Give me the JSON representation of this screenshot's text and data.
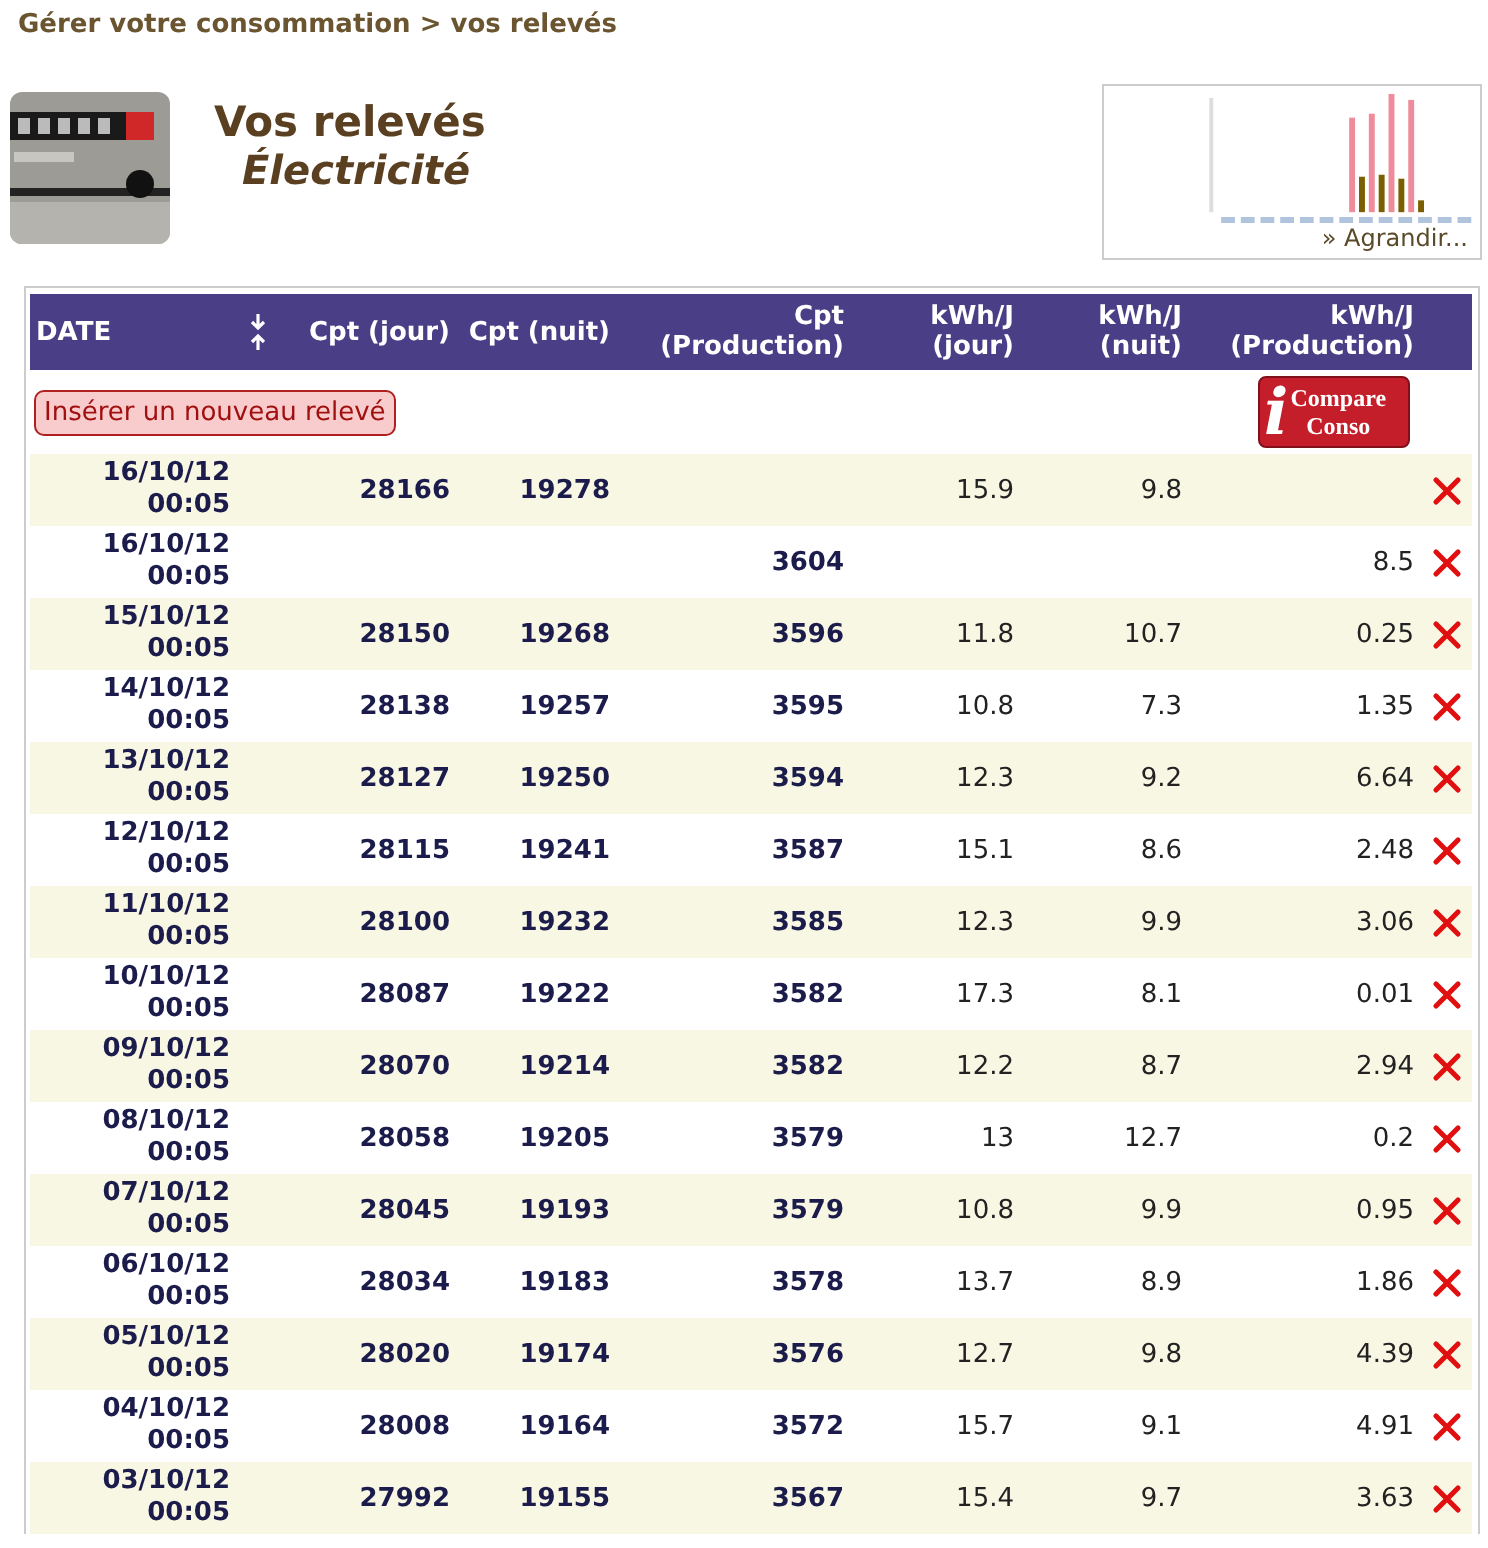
{
  "breadcrumb": "Gérer votre consommation > vos relevés",
  "header": {
    "title": "Vos relevés",
    "subtitle": "Électricité"
  },
  "thumbnail": {
    "link": "» Agrandir..."
  },
  "table": {
    "columns": [
      "DATE",
      "Cpt (jour)",
      "Cpt (nuit)",
      "Cpt (Production)",
      "kWh/J (jour)",
      "kWh/J (nuit)",
      "kWh/J (Production)"
    ],
    "insert_button": "Insérer un nouveau relevé",
    "compare_button": {
      "icon": "i",
      "label": "Compare Conso"
    },
    "rows": [
      {
        "date": "16/10/12 00:05",
        "cpt_jour": "28166",
        "cpt_nuit": "19278",
        "cpt_prod": "",
        "kwh_jour": "15.9",
        "kwh_nuit": "9.8",
        "kwh_prod": ""
      },
      {
        "date": "16/10/12 00:05",
        "cpt_jour": "",
        "cpt_nuit": "",
        "cpt_prod": "3604",
        "kwh_jour": "",
        "kwh_nuit": "",
        "kwh_prod": "8.5"
      },
      {
        "date": "15/10/12 00:05",
        "cpt_jour": "28150",
        "cpt_nuit": "19268",
        "cpt_prod": "3596",
        "kwh_jour": "11.8",
        "kwh_nuit": "10.7",
        "kwh_prod": "0.25"
      },
      {
        "date": "14/10/12 00:05",
        "cpt_jour": "28138",
        "cpt_nuit": "19257",
        "cpt_prod": "3595",
        "kwh_jour": "10.8",
        "kwh_nuit": "7.3",
        "kwh_prod": "1.35"
      },
      {
        "date": "13/10/12 00:05",
        "cpt_jour": "28127",
        "cpt_nuit": "19250",
        "cpt_prod": "3594",
        "kwh_jour": "12.3",
        "kwh_nuit": "9.2",
        "kwh_prod": "6.64"
      },
      {
        "date": "12/10/12 00:05",
        "cpt_jour": "28115",
        "cpt_nuit": "19241",
        "cpt_prod": "3587",
        "kwh_jour": "15.1",
        "kwh_nuit": "8.6",
        "kwh_prod": "2.48"
      },
      {
        "date": "11/10/12 00:05",
        "cpt_jour": "28100",
        "cpt_nuit": "19232",
        "cpt_prod": "3585",
        "kwh_jour": "12.3",
        "kwh_nuit": "9.9",
        "kwh_prod": "3.06"
      },
      {
        "date": "10/10/12 00:05",
        "cpt_jour": "28087",
        "cpt_nuit": "19222",
        "cpt_prod": "3582",
        "kwh_jour": "17.3",
        "kwh_nuit": "8.1",
        "kwh_prod": "0.01"
      },
      {
        "date": "09/10/12 00:05",
        "cpt_jour": "28070",
        "cpt_nuit": "19214",
        "cpt_prod": "3582",
        "kwh_jour": "12.2",
        "kwh_nuit": "8.7",
        "kwh_prod": "2.94"
      },
      {
        "date": "08/10/12 00:05",
        "cpt_jour": "28058",
        "cpt_nuit": "19205",
        "cpt_prod": "3579",
        "kwh_jour": "13",
        "kwh_nuit": "12.7",
        "kwh_prod": "0.2"
      },
      {
        "date": "07/10/12 00:05",
        "cpt_jour": "28045",
        "cpt_nuit": "19193",
        "cpt_prod": "3579",
        "kwh_jour": "10.8",
        "kwh_nuit": "9.9",
        "kwh_prod": "0.95"
      },
      {
        "date": "06/10/12 00:05",
        "cpt_jour": "28034",
        "cpt_nuit": "19183",
        "cpt_prod": "3578",
        "kwh_jour": "13.7",
        "kwh_nuit": "8.9",
        "kwh_prod": "1.86"
      },
      {
        "date": "05/10/12 00:05",
        "cpt_jour": "28020",
        "cpt_nuit": "19174",
        "cpt_prod": "3576",
        "kwh_jour": "12.7",
        "kwh_nuit": "9.8",
        "kwh_prod": "4.39"
      },
      {
        "date": "04/10/12 00:05",
        "cpt_jour": "28008",
        "cpt_nuit": "19164",
        "cpt_prod": "3572",
        "kwh_jour": "15.7",
        "kwh_nuit": "9.1",
        "kwh_prod": "4.91"
      },
      {
        "date": "03/10/12 00:05",
        "cpt_jour": "27992",
        "cpt_nuit": "19155",
        "cpt_prod": "3567",
        "kwh_jour": "15.4",
        "kwh_nuit": "9.7",
        "kwh_prod": "3.63"
      }
    ]
  }
}
